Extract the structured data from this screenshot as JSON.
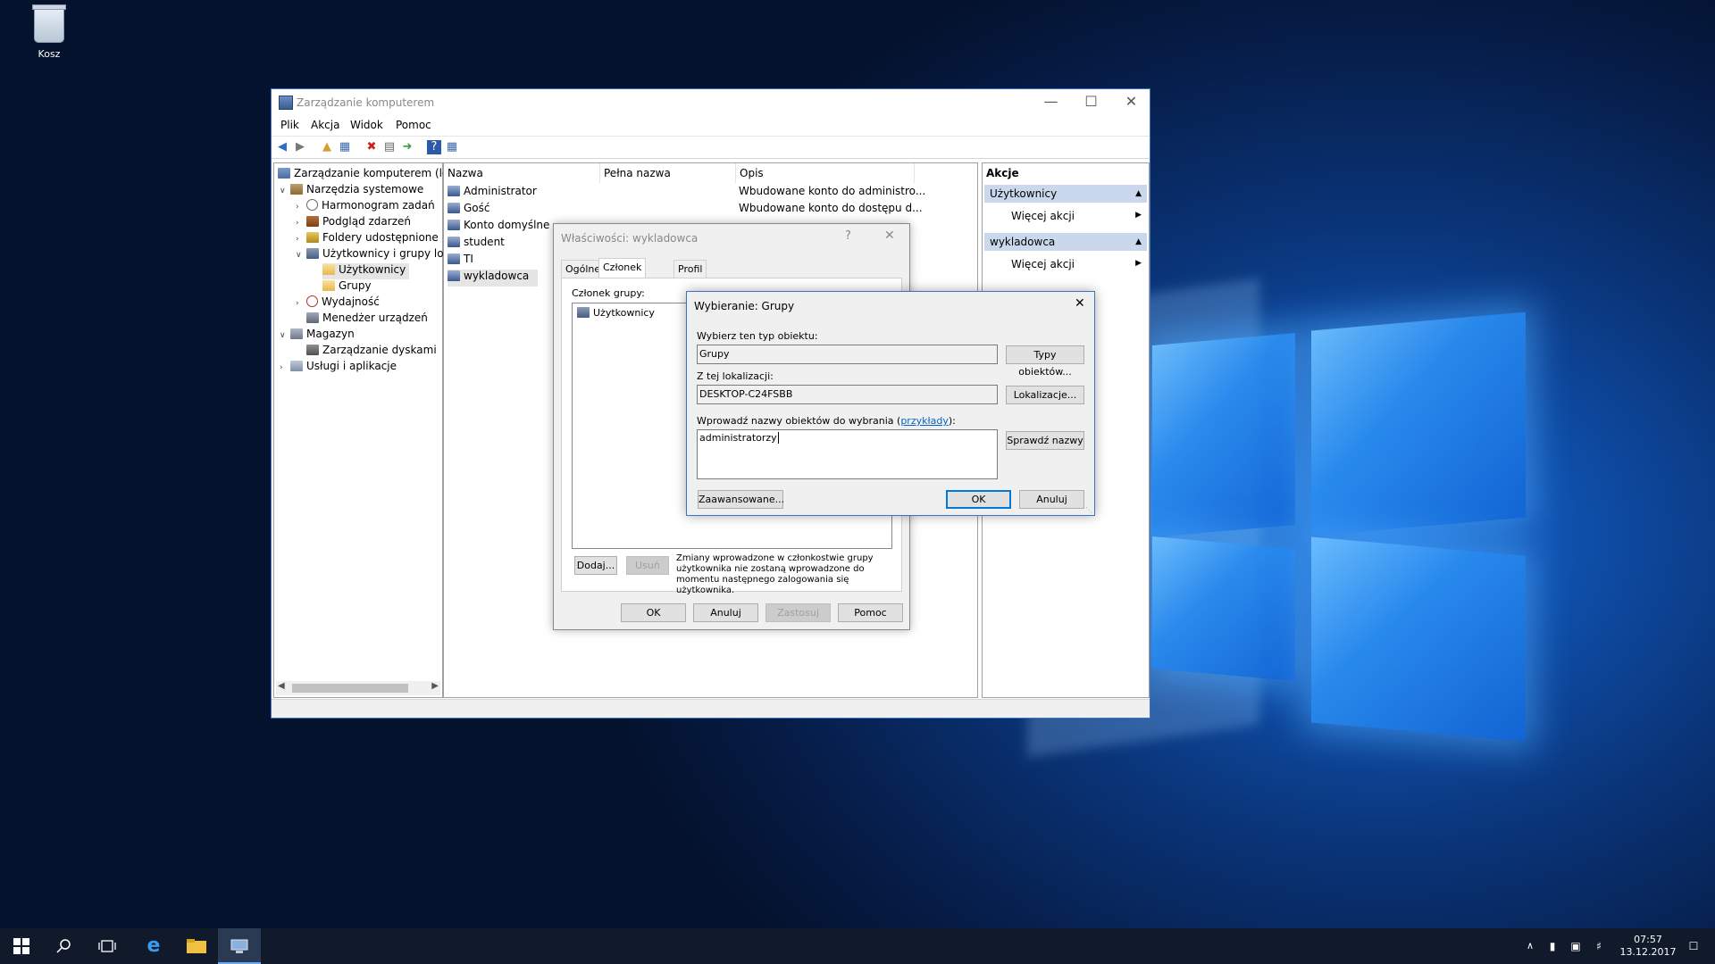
{
  "desktop": {
    "recycle_bin_label": "Kosz"
  },
  "mainwin": {
    "title": "Zarządzanie komputerem",
    "menu": [
      "Plik",
      "Akcja",
      "Widok",
      "Pomoc"
    ],
    "tree": {
      "root": "Zarządzanie komputerem (loka",
      "system_tools": "Narzędzia systemowe",
      "scheduler": "Harmonogram zadań",
      "event_viewer": "Podgląd zdarzeń",
      "shared_folders": "Foldery udostępnione",
      "local_users": "Użytkownicy i grupy lok",
      "users": "Użytkownicy",
      "groups": "Grupy",
      "performance": "Wydajność",
      "device_manager": "Menedżer urządzeń",
      "storage": "Magazyn",
      "disk_mgmt": "Zarządzanie dyskami",
      "services": "Usługi i aplikacje"
    },
    "list": {
      "headers": {
        "name": "Nazwa",
        "full_name": "Pełna nazwa",
        "desc": "Opis"
      },
      "rows": [
        {
          "name": "Administrator",
          "desc": "Wbudowane konto do administro..."
        },
        {
          "name": "Gość",
          "desc": "Wbudowane konto do dostępu d..."
        },
        {
          "name": "Konto domyślne",
          "desc": ""
        },
        {
          "name": "student",
          "desc": ""
        },
        {
          "name": "TI",
          "desc": ""
        },
        {
          "name": "wykladowca",
          "desc": ""
        }
      ]
    },
    "actions": {
      "header": "Akcje",
      "section1": "Użytkownicy",
      "more1": "Więcej akcji",
      "section2": "wykladowca",
      "more2": "Więcej akcji"
    }
  },
  "props": {
    "title": "Właściwości: wykladowca",
    "help_glyph": "?",
    "tabs": [
      "Ogólne",
      "Członek grupy",
      "Profil"
    ],
    "member_label": "Członek grupy:",
    "members": [
      "Użytkownicy"
    ],
    "add": "Dodaj...",
    "remove": "Usuń",
    "note": "Zmiany wprowadzone w członkostwie grupy użytkownika nie zostaną wprowadzone do momentu następnego zalogowania się użytkownika.",
    "ok": "OK",
    "cancel": "Anuluj",
    "apply": "Zastosuj",
    "help": "Pomoc"
  },
  "selg": {
    "title": "Wybieranie: Grupy",
    "type_label": "Wybierz ten typ obiektu:",
    "type_value": "Grupy",
    "type_btn": "Typy obiektów...",
    "loc_label": "Z tej lokalizacji:",
    "loc_value": "DESKTOP-C24FSBB",
    "loc_btn": "Lokalizacje...",
    "names_label": "Wprowadź nazwy obiektów do wybrania (",
    "names_link": "przykłady",
    "names_label_end": "):",
    "names_value": "administratorzy",
    "check_btn": "Sprawdź nazwy",
    "advanced_btn": "Zaawansowane...",
    "ok": "OK",
    "cancel": "Anuluj"
  },
  "taskbar": {
    "time": "07:57",
    "date": "13.12.2017"
  }
}
